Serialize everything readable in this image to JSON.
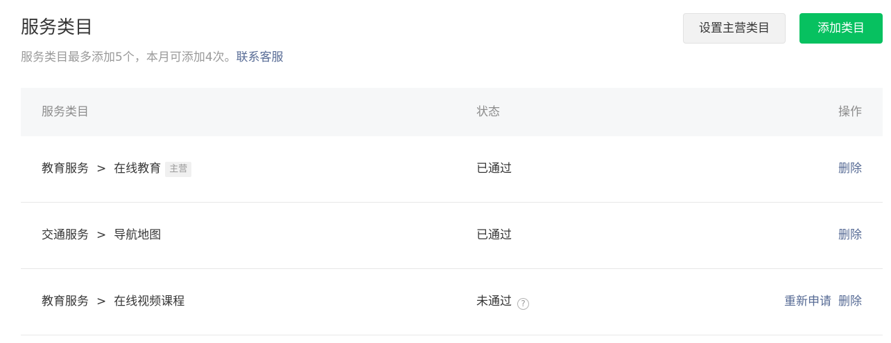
{
  "header": {
    "title": "服务类目",
    "subtitle_text": "服务类目最多添加5个，本月可添加4次。",
    "subtitle_link": "联系客服",
    "set_main_button": "设置主营类目",
    "add_button": "添加类目"
  },
  "table": {
    "columns": {
      "category": "服务类目",
      "status": "状态",
      "actions": "操作"
    },
    "separator": ">",
    "rows": [
      {
        "parent": "教育服务",
        "child": "在线教育",
        "tag": "主营",
        "status": "已通过",
        "actions": [
          "删除"
        ]
      },
      {
        "parent": "交通服务",
        "child": "导航地图",
        "status": "已通过",
        "actions": [
          "删除"
        ]
      },
      {
        "parent": "教育服务",
        "child": "在线视频课程",
        "status": "未通过",
        "status_help_icon": "question-circle-icon",
        "actions": [
          "重新申请",
          "删除"
        ]
      }
    ]
  },
  "colors": {
    "primary": "#07c160",
    "link": "#576b95"
  }
}
